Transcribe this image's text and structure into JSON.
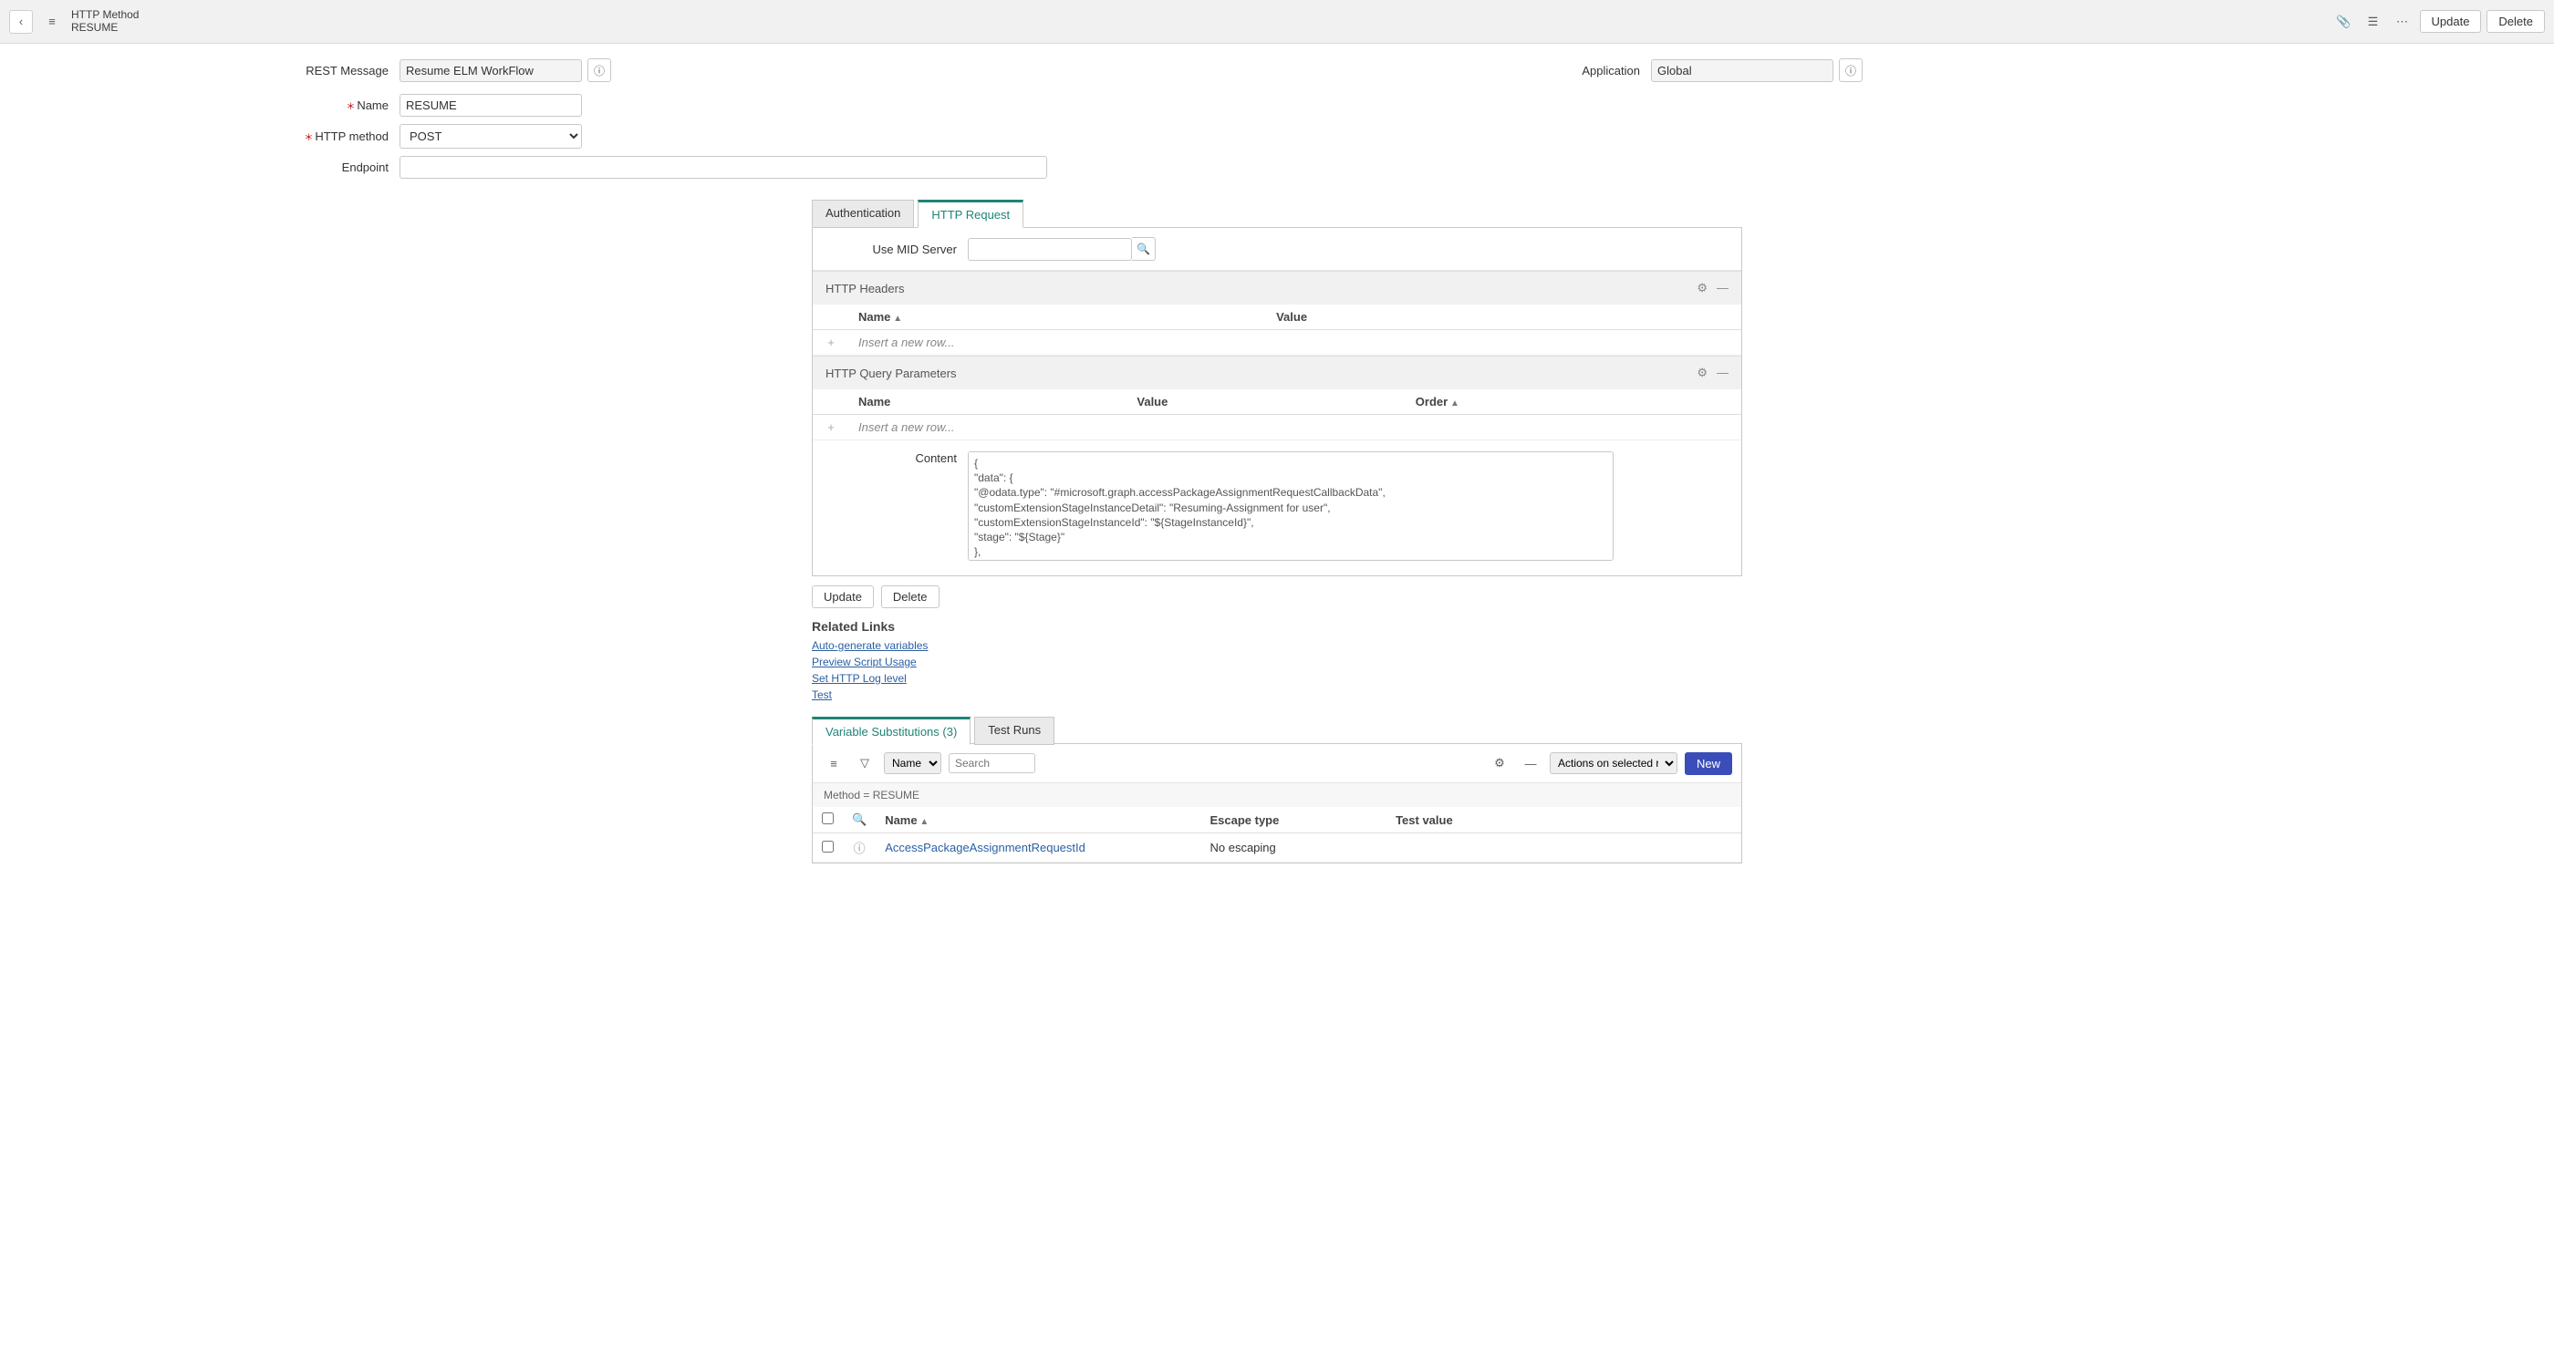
{
  "header": {
    "title_primary": "HTTP Method",
    "title_secondary": "RESUME",
    "update_label": "Update",
    "delete_label": "Delete"
  },
  "form": {
    "rest_message": {
      "label": "REST Message",
      "value": "Resume ELM WorkFlow"
    },
    "application": {
      "label": "Application",
      "value": "Global"
    },
    "name": {
      "label": "Name",
      "value": "RESUME"
    },
    "http_method": {
      "label": "HTTP method",
      "value": "POST"
    },
    "endpoint": {
      "label": "Endpoint",
      "value": ""
    }
  },
  "request_tabs": {
    "auth": "Authentication",
    "http": "HTTP Request"
  },
  "mid_server": {
    "label": "Use MID Server",
    "value": ""
  },
  "headers_section": {
    "title": "HTTP Headers",
    "col_name": "Name",
    "col_value": "Value",
    "placeholder": "Insert a new row..."
  },
  "query_section": {
    "title": "HTTP Query Parameters",
    "col_name": "Name",
    "col_value": "Value",
    "col_order": "Order",
    "placeholder": "Insert a new row..."
  },
  "content": {
    "label": "Content",
    "value": "{\n\"data\": {\n\"@odata.type\": \"#microsoft.graph.accessPackageAssignmentRequestCallbackData\",\n\"customExtensionStageInstanceDetail\": \"Resuming-Assignment for user\",\n\"customExtensionStageInstanceId\": \"${StageInstanceId}\",\n\"stage\": \"${Stage}\"\n},\n\"source\": \"ServiceNow\",\n\"type\": \"microsoft.graph.accessPackageCustomExtensionStage.${Stage}\"\n}"
  },
  "action_row": {
    "update": "Update",
    "delete": "Delete"
  },
  "related_links": {
    "title": "Related Links",
    "l1": "Auto-generate variables",
    "l2": "Preview Script Usage",
    "l3": "Set HTTP Log level",
    "l4": "Test"
  },
  "lower_tabs": {
    "vars": "Variable Substitutions (3)",
    "runs": "Test Runs"
  },
  "list_toolbar": {
    "search_field": "Name",
    "search_placeholder": "Search",
    "actions_placeholder": "Actions on selected rows...",
    "new_label": "New"
  },
  "list": {
    "breadcrumb": "Method = RESUME",
    "col_name": "Name",
    "col_escape": "Escape type",
    "col_test": "Test value",
    "rows": [
      {
        "name": "AccessPackageAssignmentRequestId",
        "escape": "No escaping",
        "test": ""
      }
    ]
  }
}
